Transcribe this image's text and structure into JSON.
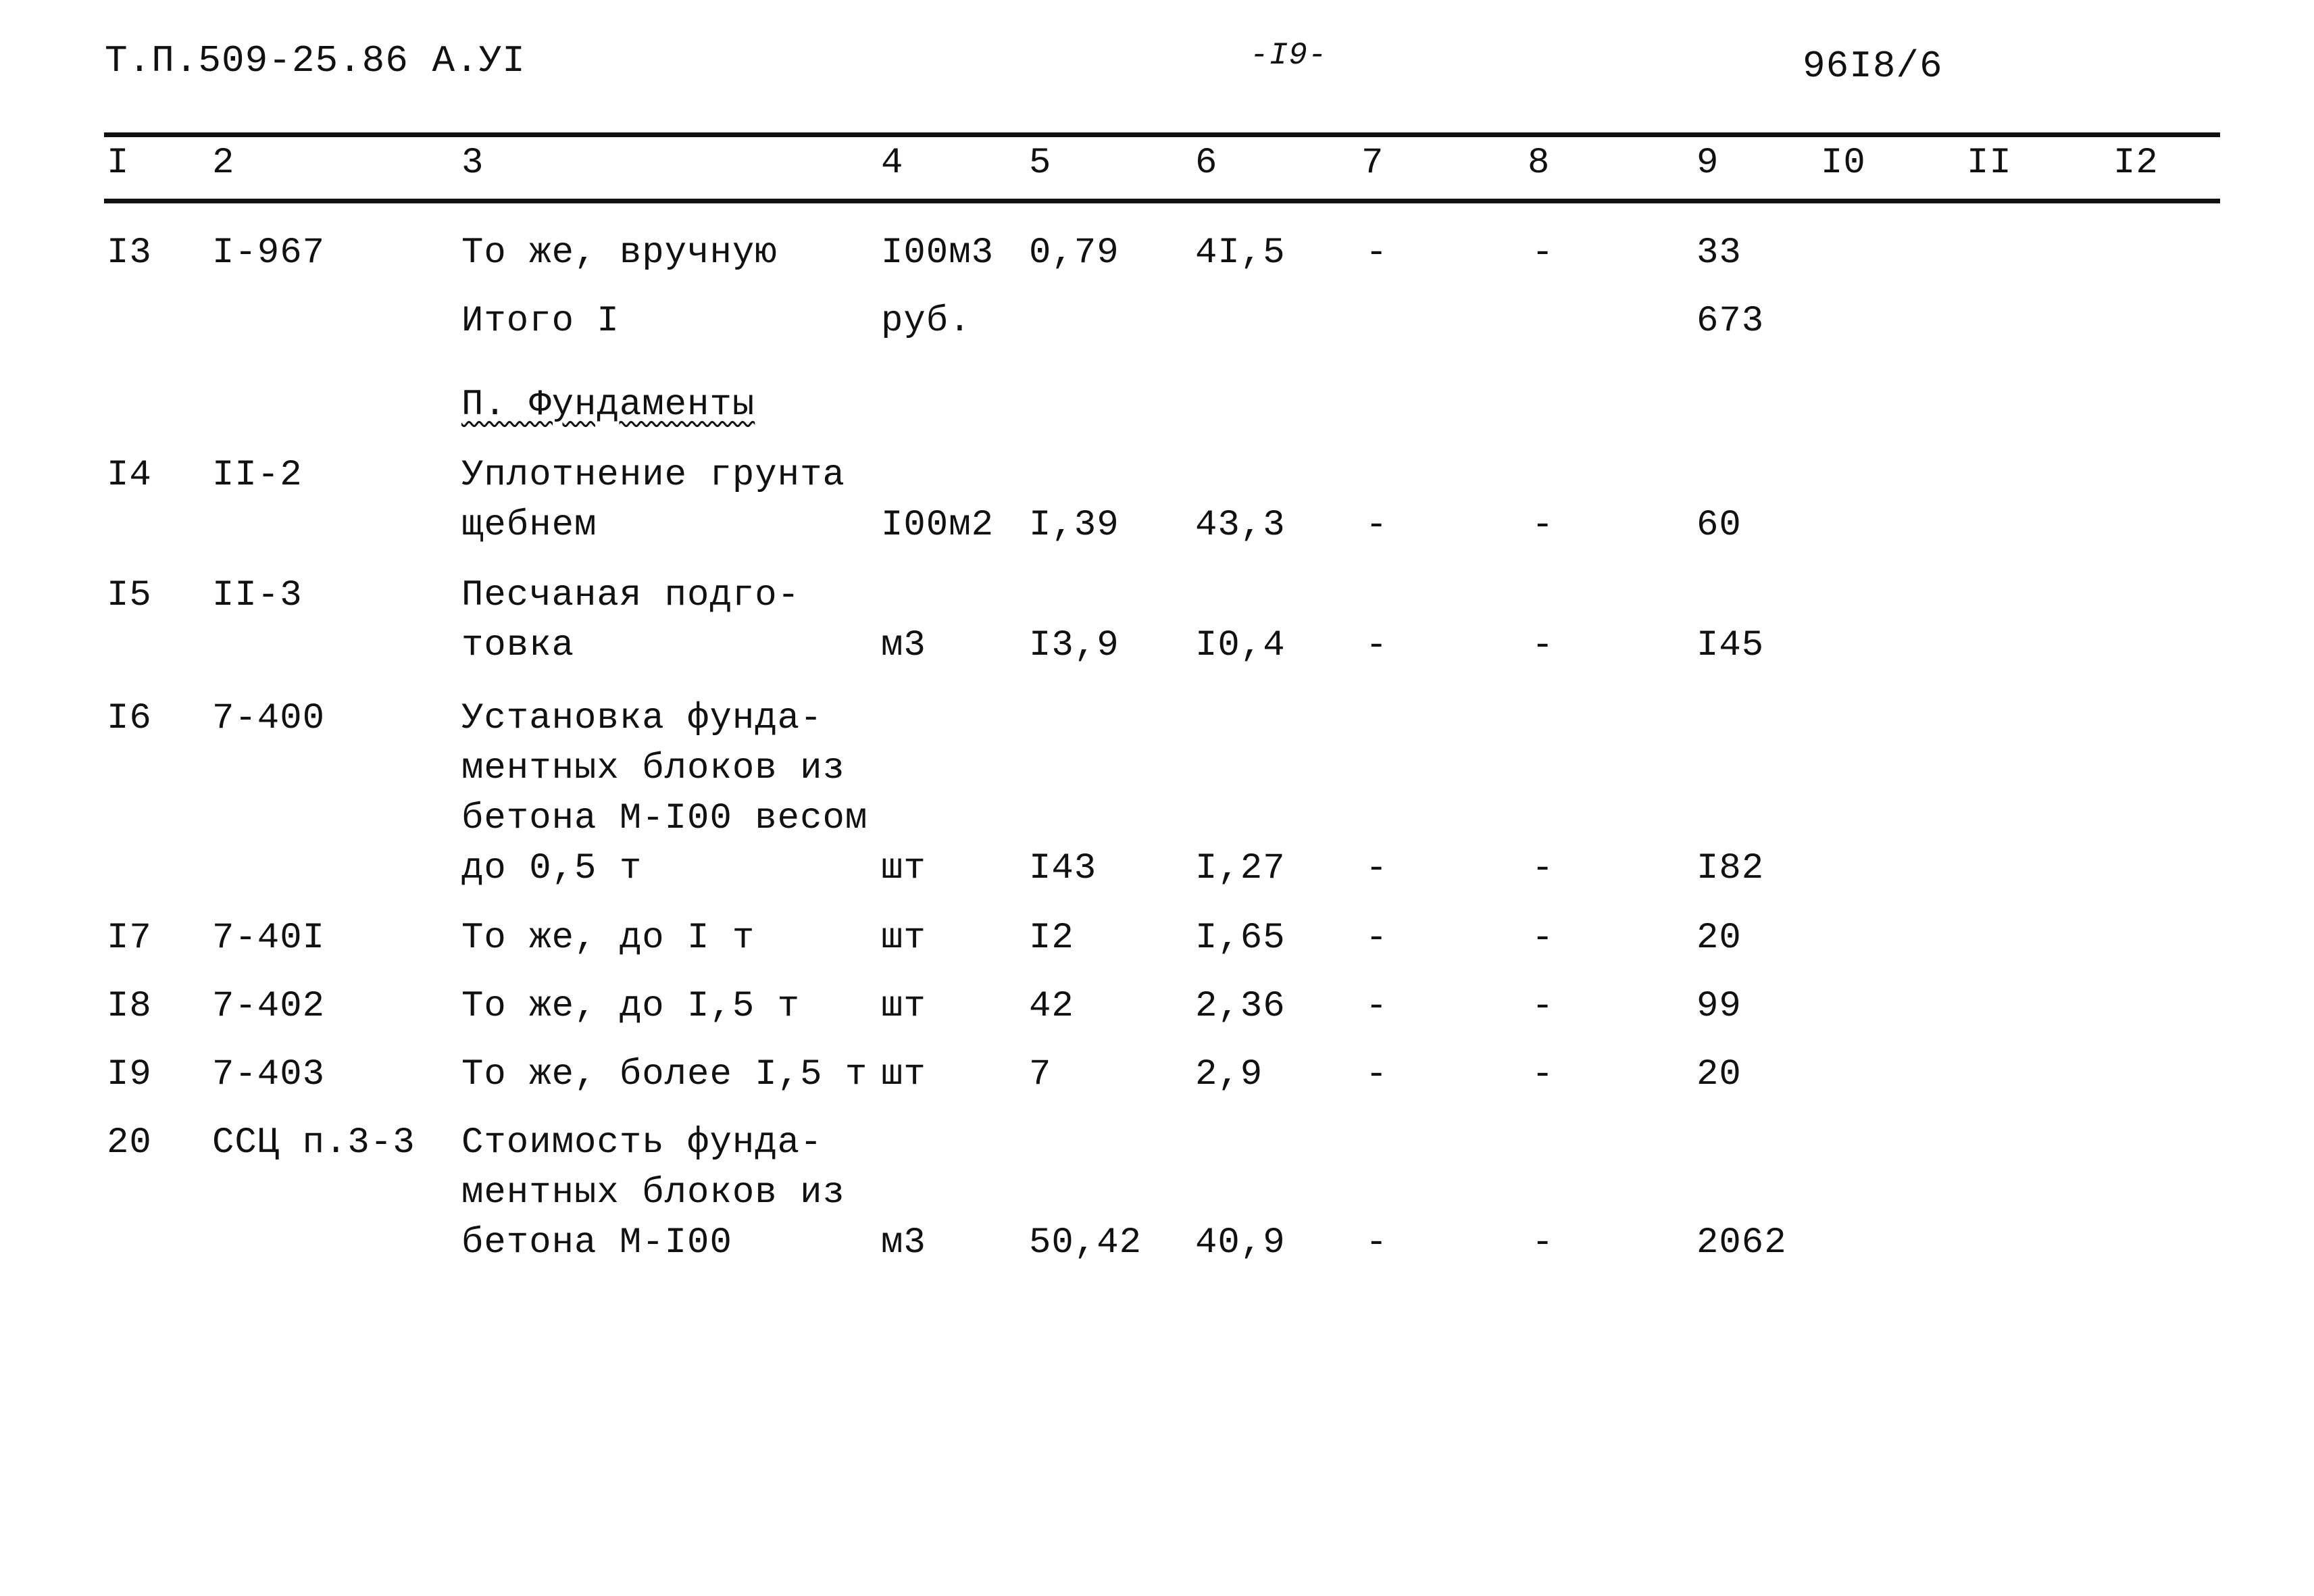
{
  "header": {
    "doc_code": "Т.П.509-25.86  А.УI",
    "page_number": "-I9-",
    "sheet_code": "96I8/6"
  },
  "table": {
    "column_numbers": [
      "I",
      "2",
      "3",
      "4",
      "5",
      "6",
      "7",
      "8",
      "9",
      "I0",
      "II",
      "I2"
    ],
    "rows": [
      {
        "no": "I3",
        "code": "I-967",
        "desc": [
          "То же, вручную"
        ],
        "unit": "I00м3",
        "c5": "0,79",
        "c6": "4I,5",
        "c7": "-",
        "c8": "-",
        "c9": "33"
      },
      {
        "no": "",
        "code": "",
        "desc": [
          "Итого I"
        ],
        "unit": "руб.",
        "c5": "",
        "c6": "",
        "c7": "",
        "c8": "",
        "c9": "673"
      },
      {
        "section": "П. Фундаменты"
      },
      {
        "no": "I4",
        "code": "II-2",
        "desc": [
          "Уплотнение грунта",
          "щебнем"
        ],
        "unit": "I00м2",
        "c5": "I,39",
        "c6": "43,3",
        "c7": "-",
        "c8": "-",
        "c9": "60"
      },
      {
        "no": "I5",
        "code": "II-3",
        "desc": [
          "Песчаная подго-",
          "товка"
        ],
        "unit": "м3",
        "c5": "I3,9",
        "c6": "I0,4",
        "c7": "-",
        "c8": "-",
        "c9": "I45"
      },
      {
        "no": "I6",
        "code": "7-400",
        "desc": [
          "Установка фунда-",
          "ментных блоков из",
          "бетона М-I00 весом",
          "до 0,5 т"
        ],
        "unit": "шт",
        "c5": "I43",
        "c6": "I,27",
        "c7": "-",
        "c8": "-",
        "c9": "I82"
      },
      {
        "no": "I7",
        "code": "7-40I",
        "desc": [
          "То же, до I т"
        ],
        "unit": "шт",
        "c5": "I2",
        "c6": "I,65",
        "c7": "-",
        "c8": "-",
        "c9": "20"
      },
      {
        "no": "I8",
        "code": "7-402",
        "desc": [
          "То же, до I,5 т"
        ],
        "unit": "шт",
        "c5": "42",
        "c6": "2,36",
        "c7": "-",
        "c8": "-",
        "c9": "99"
      },
      {
        "no": "I9",
        "code": "7-403",
        "desc": [
          "То же, более I,5 т"
        ],
        "unit": "шт",
        "c5": "7",
        "c6": "2,9",
        "c7": "-",
        "c8": "-",
        "c9": "20"
      },
      {
        "no": "20",
        "code": "ССЦ п.3-3",
        "desc": [
          "Стоимость фунда-",
          "ментных блоков из",
          "бетона М-I00"
        ],
        "unit": "м3",
        "c5": "50,42",
        "c6": "40,9",
        "c7": "-",
        "c8": "-",
        "c9": "2062"
      }
    ]
  }
}
